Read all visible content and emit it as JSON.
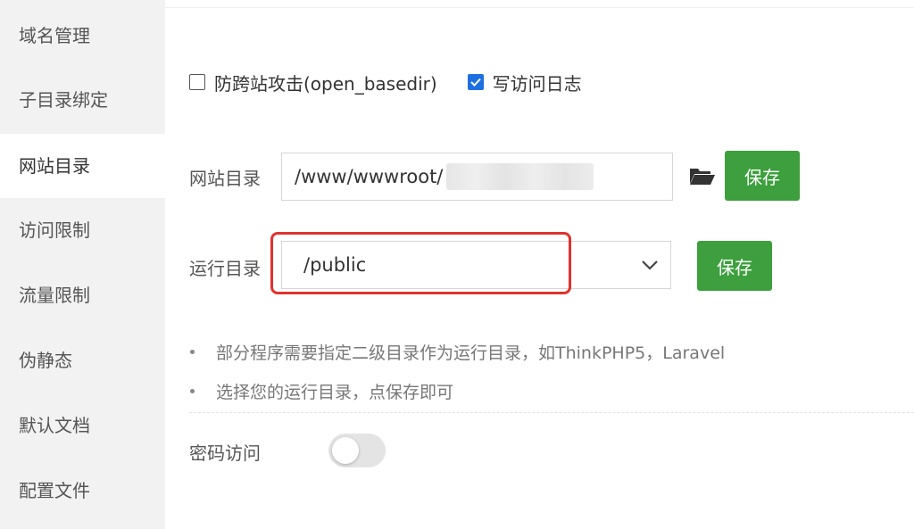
{
  "sidebar": {
    "items": [
      {
        "label": "域名管理"
      },
      {
        "label": "子目录绑定"
      },
      {
        "label": "网站目录"
      },
      {
        "label": "访问限制"
      },
      {
        "label": "流量限制"
      },
      {
        "label": "伪静态"
      },
      {
        "label": "默认文档"
      },
      {
        "label": "配置文件"
      }
    ],
    "active": "网站目录"
  },
  "options": {
    "anti_xss": {
      "label": "防跨站攻击(open_basedir)",
      "checked": false
    },
    "access_log": {
      "label": "写访问日志",
      "checked": true
    }
  },
  "site_dir": {
    "label": "网站目录",
    "value": "/www/wwwroot/",
    "save_label": "保存"
  },
  "run_dir": {
    "label": "运行目录",
    "value": "/public",
    "save_label": "保存"
  },
  "tips": [
    "部分程序需要指定二级目录作为运行目录，如ThinkPHP5，Laravel",
    "选择您的运行目录，点保存即可"
  ],
  "password_access": {
    "label": "密码访问",
    "enabled": false
  },
  "colors": {
    "accent": "#3d9f3d",
    "checkbox": "#1e6fe0",
    "highlight": "#e0322f"
  },
  "icons": {
    "folder": "folder-open-icon",
    "dropdown": "chevron-down-icon",
    "check": "check-icon"
  }
}
